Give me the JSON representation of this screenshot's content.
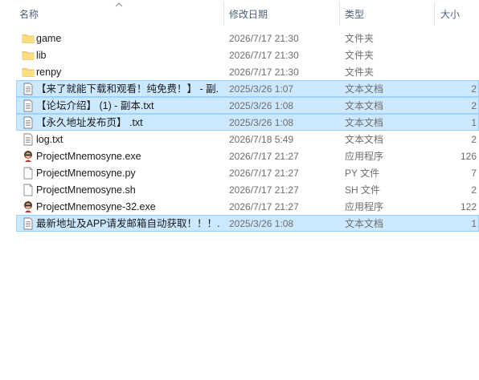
{
  "columns": {
    "name": "名称",
    "date": "修改日期",
    "type": "类型",
    "size": "大小"
  },
  "files": [
    {
      "icon": "folder-icon",
      "name": "game",
      "date": "2026/7/17 21:30",
      "type": "文件夹",
      "size": "",
      "selected": false
    },
    {
      "icon": "folder-icon",
      "name": "lib",
      "date": "2026/7/17 21:30",
      "type": "文件夹",
      "size": "",
      "selected": false
    },
    {
      "icon": "folder-icon",
      "name": "renpy",
      "date": "2026/7/17 21:30",
      "type": "文件夹",
      "size": "",
      "selected": false
    },
    {
      "icon": "text-document-icon",
      "name": "【来了就能下载和观看！纯免费！】 - 副...",
      "date": "2025/3/26 1:07",
      "type": "文本文档",
      "size": "2",
      "selected": true
    },
    {
      "icon": "text-document-icon",
      "name": "【论坛介绍】 (1) - 副本.txt",
      "date": "2025/3/26 1:08",
      "type": "文本文档",
      "size": "2",
      "selected": true
    },
    {
      "icon": "text-document-icon",
      "name": "【永久地址发布页】 .txt",
      "date": "2025/3/26 1:08",
      "type": "文本文档",
      "size": "1",
      "selected": true
    },
    {
      "icon": "text-document-icon",
      "name": "log.txt",
      "date": "2026/7/18 5:49",
      "type": "文本文档",
      "size": "2",
      "selected": false
    },
    {
      "icon": "app-character-icon",
      "name": "ProjectMnemosyne.exe",
      "date": "2026/7/17 21:27",
      "type": "应用程序",
      "size": "126",
      "selected": false
    },
    {
      "icon": "python-file-icon",
      "name": "ProjectMnemosyne.py",
      "date": "2026/7/17 21:27",
      "type": "PY 文件",
      "size": "7",
      "selected": false
    },
    {
      "icon": "shell-file-icon",
      "name": "ProjectMnemosyne.sh",
      "date": "2026/7/17 21:27",
      "type": "SH 文件",
      "size": "2",
      "selected": false
    },
    {
      "icon": "app-character-icon",
      "name": "ProjectMnemosyne-32.exe",
      "date": "2026/7/17 21:27",
      "type": "应用程序",
      "size": "122",
      "selected": false
    },
    {
      "icon": "text-document-icon",
      "name": "最新地址及APP请发邮箱自动获取！！！...",
      "date": "2025/3/26 1:08",
      "type": "文本文档",
      "size": "1",
      "selected": true
    }
  ],
  "colors": {
    "selection_bg": "#cce8ff",
    "selection_border": "#99d1ff",
    "folder": "#f8d775",
    "header_text": "#4c607a"
  }
}
